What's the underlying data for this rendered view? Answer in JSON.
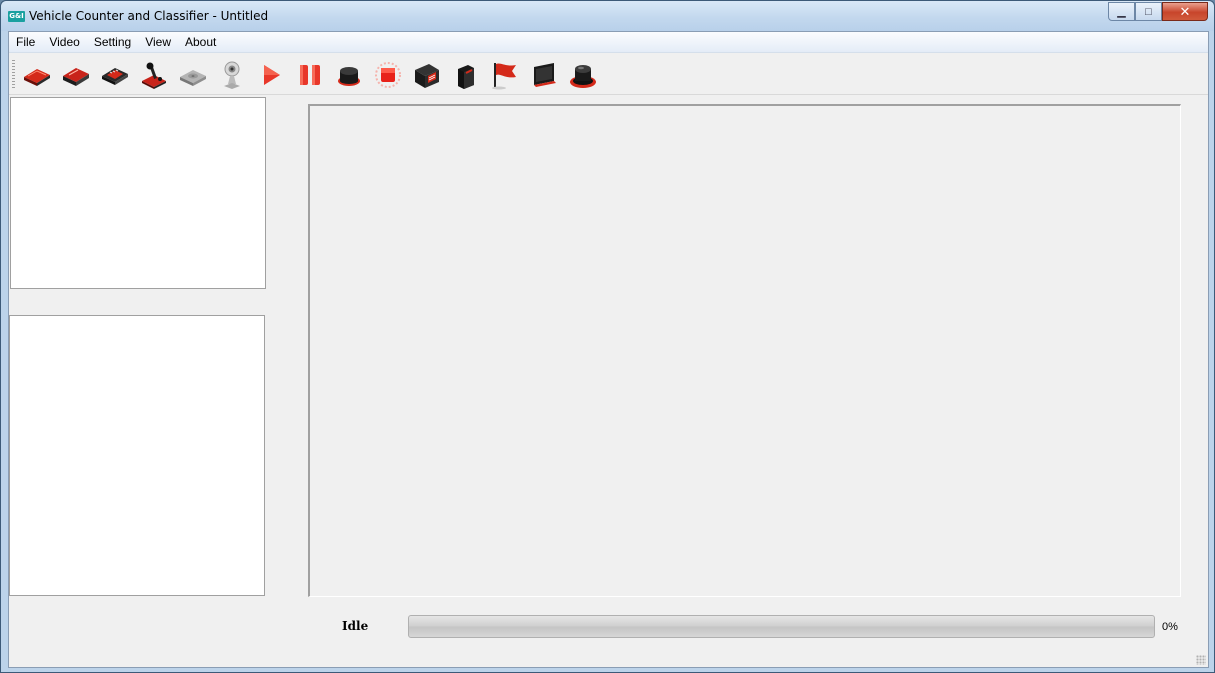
{
  "window": {
    "title": "Vehicle Counter and Classifier - Untitled",
    "icon_text": "G&I",
    "minimize_glyph": "▁",
    "maximize_glyph": "□",
    "close_glyph": "✕"
  },
  "menu": [
    "File",
    "Video",
    "Setting",
    "View",
    "About"
  ],
  "toolbar": {
    "icons": [
      "open-file-icon",
      "save-file-icon",
      "film-icon",
      "joystick-icon",
      "disk-icon",
      "webcam-icon",
      "play-icon",
      "pause-icon",
      "record-button-icon",
      "stop-icon",
      "calendar-icon",
      "bag-icon",
      "flag-icon",
      "monitor-icon",
      "alarm-icon"
    ],
    "accent": "#d42a1a"
  },
  "status": {
    "label": "Idle",
    "progress_percent": 0,
    "progress_text": "0%"
  }
}
